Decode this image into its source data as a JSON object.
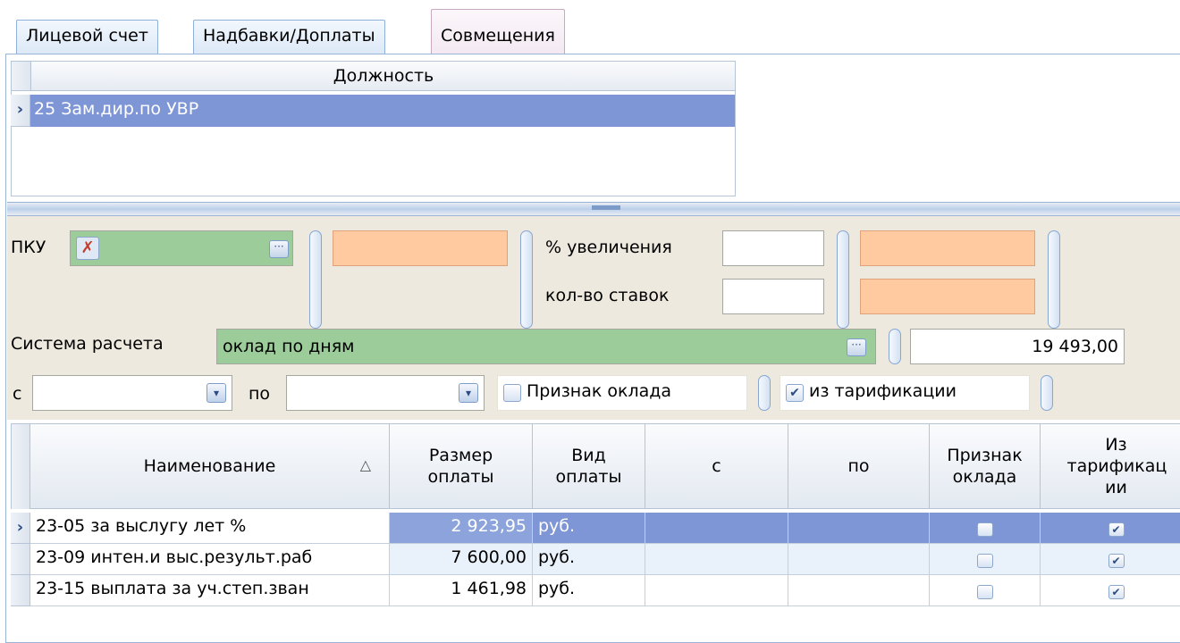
{
  "tabs": [
    {
      "label": "Лицевой счет"
    },
    {
      "label": "Надбавки/Доплаты"
    },
    {
      "label": "Совмещения"
    }
  ],
  "positions_grid": {
    "header": "Должность",
    "rows": [
      {
        "label": "25 Зам.дир.по УВР"
      }
    ]
  },
  "form": {
    "pku_label": "ПКУ",
    "pku_value": "",
    "increase_label": "% увеличения",
    "rates_label": "кол-во ставок",
    "increase_value": "",
    "rates_value": "",
    "calc_system_label": "Система расчета",
    "calc_system_value": "оклад по дням",
    "amount_value": "19 493,00",
    "from_label": "с",
    "to_label": "по",
    "from_value": "",
    "to_value": "",
    "salary_sign_label": "Признак оклада",
    "salary_sign_checked": false,
    "from_tariff_label": "из тарификации",
    "from_tariff_checked": true
  },
  "payments_grid": {
    "columns": {
      "name": "Наименование",
      "size": "Размер оплаты",
      "kind": "Вид оплаты",
      "from": "с",
      "to": "по",
      "salary_sign": "Признак оклада",
      "from_tariff": "Из тарификац ии"
    },
    "sort_indicator": "△",
    "rows": [
      {
        "name": "23-05 за выслугу лет %",
        "size": "2 923,95",
        "kind": "руб.",
        "from": "",
        "to": "",
        "salary_sign": false,
        "from_tariff": true
      },
      {
        "name": "23-09 интен.и выс.результ.раб",
        "size": "7 600,00",
        "kind": "руб.",
        "from": "",
        "to": "",
        "salary_sign": false,
        "from_tariff": true
      },
      {
        "name": "23-15 выплата за уч.степ.зван",
        "size": "1 461,98",
        "kind": "руб.",
        "from": "",
        "to": "",
        "salary_sign": false,
        "from_tariff": true
      }
    ]
  },
  "icons": {
    "row_pointer": "chevron-right-icon",
    "ellipsis": "ellipsis-icon",
    "dropdown": "chevron-down-icon",
    "check": "check-icon",
    "pku_picker": "person-icon"
  },
  "colors": {
    "selection": "#7e95d6",
    "field_green": "#9bcc99",
    "field_orange": "#ffcaa0",
    "panel": "#ede9de"
  }
}
